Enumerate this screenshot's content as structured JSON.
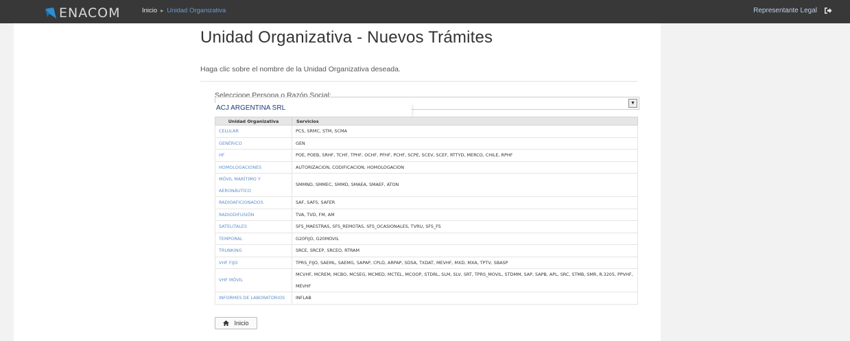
{
  "header": {
    "brand": "ENACOM",
    "breadcrumb": [
      "Inicio",
      "Unidad Organizativa"
    ],
    "user_label": "Representante Legal",
    "logout_icon": "sign-out-icon"
  },
  "main": {
    "title": "Unidad Organizativa - Nuevos Trámites",
    "hint": "Haga clic sobre el nombre de la Unidad Organizativa deseada.",
    "select_label": "Seleccione Persona o Razón Social:",
    "select_value": "ACJ ARGENTINA SRL",
    "table": {
      "headers": [
        "Unidad Organizativa",
        "Servicios"
      ],
      "rows": [
        {
          "unit": "CELULAR",
          "services": "PCS, SRMC, STM, SCMA"
        },
        {
          "unit": "GENÉRICO",
          "services": "GEN"
        },
        {
          "unit": "HF",
          "services": "POE, POEB, SRHF, TCHF, TPHF, OCHF, PFHF, PCHF, SCPE, SCEV, SCEF, RTTYD, MERCO, CHILE, RPHF"
        },
        {
          "unit": "HOMOLOGACIONES",
          "services": "AUTORIZACION, CODIFICACION, HOMOLOGACION"
        },
        {
          "unit": "MÓVIL MARÍTIMO Y AERONÁUTICO",
          "services": "SMMND, SMMEC, SMMD, SMAEA, SMAEF, ATON"
        },
        {
          "unit": "RADIOAFICIONADOS",
          "services": "SAF, SAFS, SAFER"
        },
        {
          "unit": "RADIODIFUSIÓN",
          "services": "TVA, TVD, FM, AM"
        },
        {
          "unit": "SATELITALES",
          "services": "SFS_MAESTRAS, SFS_REMOTAS, SFS_OCASIONALES, TVRU, SFS_FS"
        },
        {
          "unit": "TEMPORAL",
          "services": "G20FIJO, G20MOVIL"
        },
        {
          "unit": "TRUNKING",
          "services": "SRCE, SRCEP, SRCEO, RTRAM"
        },
        {
          "unit": "VHF FIJO",
          "services": "TPRS_FIJO, SAEML, SAEMG, SAPAP, CPLD, ARPAP, SDSA, TXDAT, MEVHF, MXD, MXA, TPTV, SBASP"
        },
        {
          "unit": "VHF MÓVIL",
          "services": "MCVHF, MCREM, MCBO, MCSEG, MCMED, MCTEL, MCOOP, STDRL, SLM, SLV, SRT, TPRS_MOVIL, STDMM, SAP, SAPB, APL, SRC, STMB, SMR, R.3205, PPVHF, MEVHF"
        },
        {
          "unit": "INFORMES DE LABORATORIOS",
          "services": "INFLAB"
        }
      ]
    },
    "home_button": "Inicio",
    "home_icon": "home-icon"
  },
  "colors": {
    "topbar": "#383838",
    "brand_mark": "#2b8fd6",
    "link": "#5b8fd0"
  }
}
